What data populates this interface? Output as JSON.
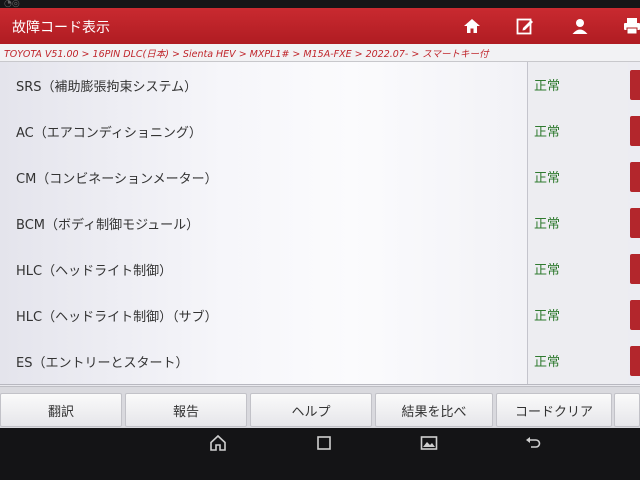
{
  "app": {
    "title": "故障コード表示",
    "breadcrumb": "TOYOTA V51.00 > 16PIN DLC(日本) > Sienta HEV > MXPL1# > M15A-FXE > 2022.07- > スマートキー付"
  },
  "header_icons": [
    "home-icon",
    "edit-report-icon",
    "user-icon",
    "printer-icon"
  ],
  "systems": [
    {
      "name": "SRS（補助膨張拘束システム）",
      "status": "正常"
    },
    {
      "name": "AC（エアコンディショニング）",
      "status": "正常"
    },
    {
      "name": "CM（コンビネーションメーター）",
      "status": "正常"
    },
    {
      "name": "BCM（ボディ制御モジュール）",
      "status": "正常"
    },
    {
      "name": "HLC（ヘッドライト制御）",
      "status": "正常"
    },
    {
      "name": "HLC（ヘッドライト制御）（サブ）",
      "status": "正常"
    },
    {
      "name": "ES（エントリーとスタート）",
      "status": "正常"
    }
  ],
  "footer": {
    "translate": "翻訳",
    "report": "報告",
    "help": "ヘルプ",
    "compare": "結果を比べ",
    "clear_codes": "コードクリア"
  },
  "nav_icons": [
    "home-nav-icon",
    "overview-nav-icon",
    "gallery-nav-icon",
    "back-nav-icon"
  ],
  "colors": {
    "header": "#c0262c",
    "status_ok": "#2f7a2f"
  }
}
